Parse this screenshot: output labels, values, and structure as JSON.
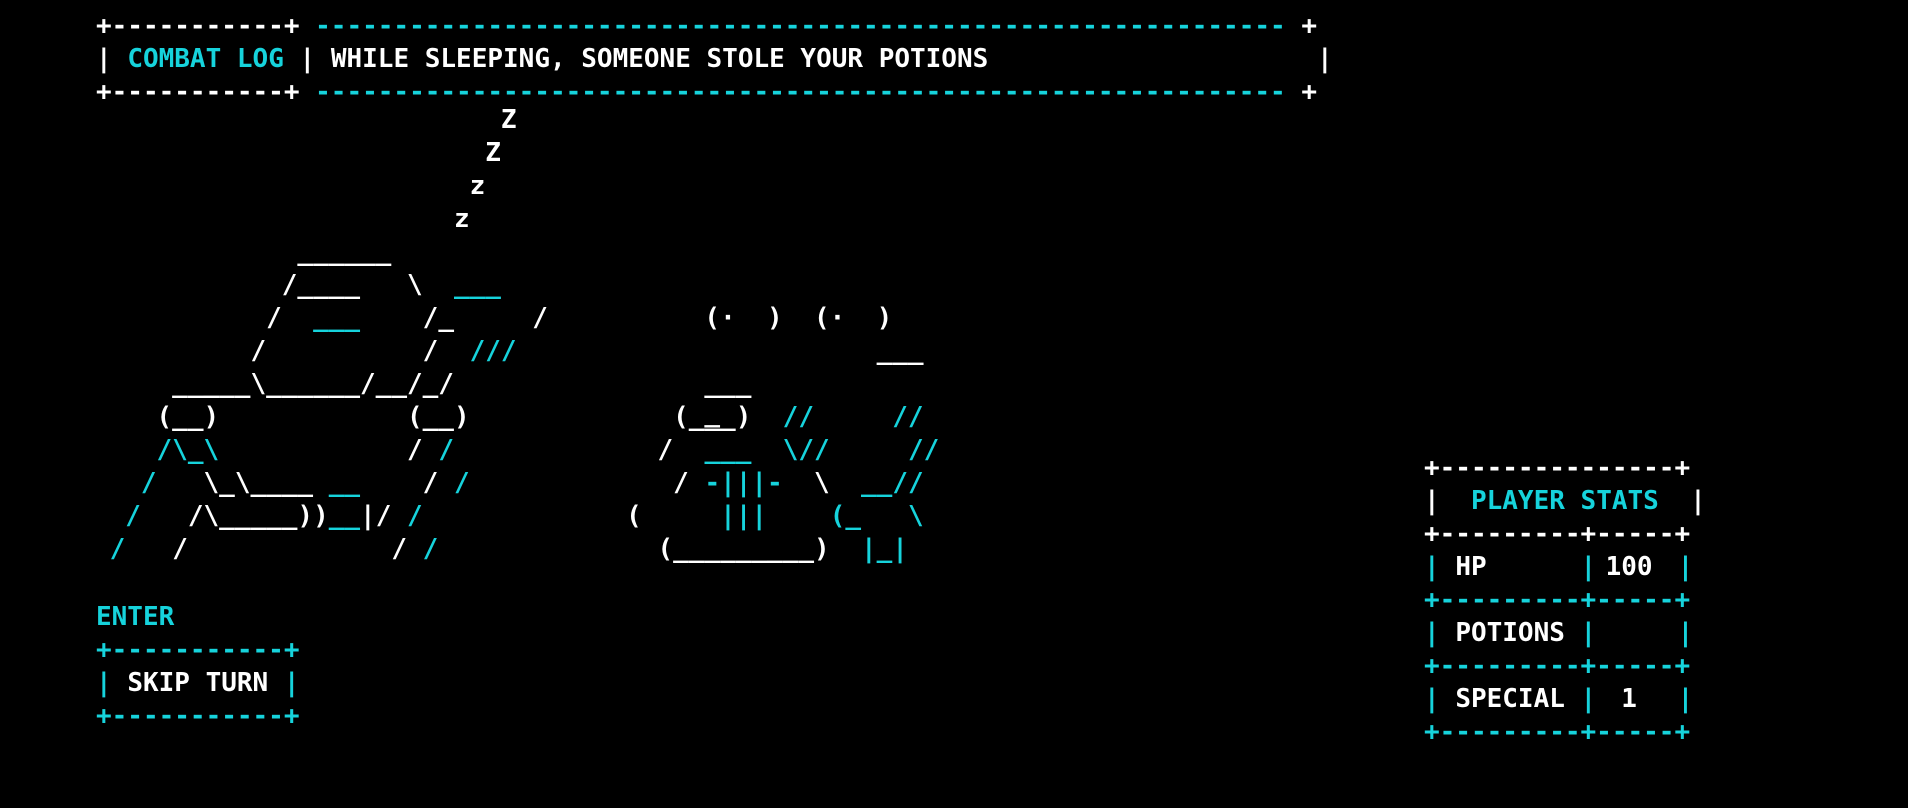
{
  "combat_log": {
    "title": "COMBAT LOG",
    "message": "WHILE SLEEPING, SOMEONE STOLE YOUR POTIONS"
  },
  "player_stats": {
    "title": "PLAYER STATS",
    "rows": [
      {
        "label": "HP",
        "value": "100"
      },
      {
        "label": "POTIONS",
        "value": ""
      },
      {
        "label": "SPECIAL",
        "value": "1"
      }
    ]
  },
  "actions": {
    "key_hint": "ENTER",
    "skip_turn_label": "SKIP TURN"
  },
  "scene": {
    "description": "",
    "colors": {
      "accent": "#16d3dc",
      "text": "#ffffff",
      "background": "#000000"
    }
  }
}
